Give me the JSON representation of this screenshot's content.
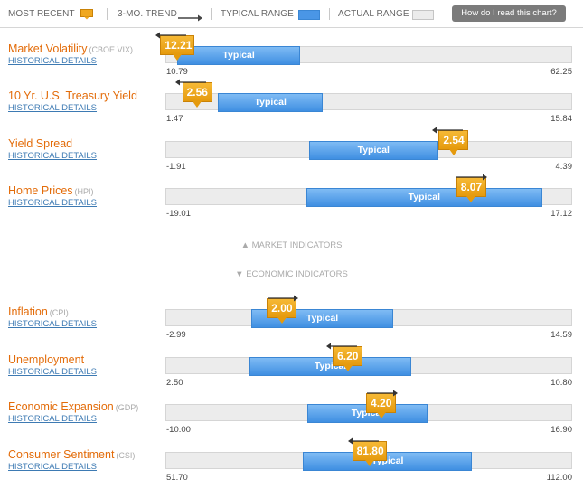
{
  "legend": {
    "most_recent": "MOST RECENT",
    "trend": "3-MO. TREND",
    "typical_range": "TYPICAL RANGE",
    "actual_range": "ACTUAL RANGE",
    "help_button": "How do I read this chart?"
  },
  "sections": {
    "market": "▲ MARKET INDICATORS",
    "economic": "▼ ECONOMIC INDICATORS"
  },
  "typical_label": "Typical",
  "indicators": [
    {
      "name": "Market Volatility",
      "abbr": "(CBOE VIX)",
      "link": "HISTORICAL DETAILS",
      "min": "10.79",
      "max": "62.25",
      "min_num": 10.79,
      "max_num": 62.25,
      "typical_low": 12.2,
      "typical_high": 27.7,
      "value": "12.21",
      "value_num": 12.21,
      "trend": "left"
    },
    {
      "name": "10 Yr. U.S. Treasury Yield",
      "abbr": "",
      "link": "HISTORICAL DETAILS",
      "min": "1.47",
      "max": "15.84",
      "min_num": 1.47,
      "max_num": 15.84,
      "typical_low": 3.3,
      "typical_high": 7.0,
      "value": "2.56",
      "value_num": 2.56,
      "trend": "left"
    },
    {
      "name": "Yield Spread",
      "abbr": "",
      "link": "HISTORICAL DETAILS",
      "min": "-1.91",
      "max": "4.39",
      "min_num": -1.91,
      "max_num": 4.39,
      "typical_low": 0.3,
      "typical_high": 2.3,
      "value": "2.54",
      "value_num": 2.54,
      "trend": "left"
    },
    {
      "name": "Home Prices",
      "abbr": "(HPI)",
      "link": "HISTORICAL DETAILS",
      "min": "-19.01",
      "max": "17.12",
      "min_num": -19.01,
      "max_num": 17.12,
      "typical_low": -6.6,
      "typical_high": 14.4,
      "value": "8.07",
      "value_num": 8.07,
      "trend": "right"
    },
    {
      "name": "Inflation",
      "abbr": "(CPI)",
      "link": "HISTORICAL DETAILS",
      "min": "-2.99",
      "max": "14.59",
      "min_num": -2.99,
      "max_num": 14.59,
      "typical_low": 0.7,
      "typical_high": 6.8,
      "value": "2.00",
      "value_num": 2.0,
      "trend": "right"
    },
    {
      "name": "Unemployment",
      "abbr": "",
      "link": "HISTORICAL DETAILS",
      "min": "2.50",
      "max": "10.80",
      "min_num": 2.5,
      "max_num": 10.8,
      "typical_low": 4.2,
      "typical_high": 7.5,
      "value": "6.20",
      "value_num": 6.2,
      "trend": "left"
    },
    {
      "name": "Economic Expansion",
      "abbr": "(GDP)",
      "link": "HISTORICAL DETAILS",
      "min": "-10.00",
      "max": "16.90",
      "min_num": -10.0,
      "max_num": 16.9,
      "typical_low": -0.7,
      "typical_high": 7.3,
      "value": "4.20",
      "value_num": 4.2,
      "trend": "right"
    },
    {
      "name": "Consumer Sentiment",
      "abbr": "(CSI)",
      "link": "HISTORICAL DETAILS",
      "min": "51.70",
      "max": "112.00",
      "min_num": 51.7,
      "max_num": 112.0,
      "typical_low": 72.0,
      "typical_high": 97.0,
      "value": "81.80",
      "value_num": 81.8,
      "trend": "left"
    }
  ],
  "colors": {
    "accent": "#e36c0a",
    "link": "#3d7ab3",
    "typical": "#4a96e6",
    "marker": "#f0a820",
    "track": "#ececec"
  }
}
